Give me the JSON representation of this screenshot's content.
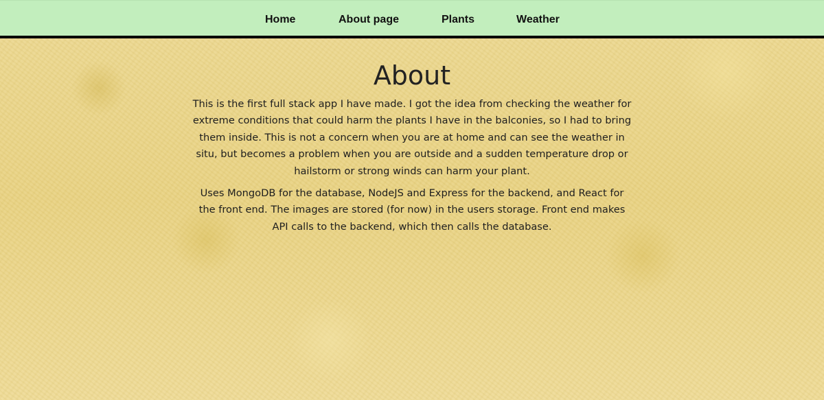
{
  "nav": {
    "items": [
      {
        "label": "Home"
      },
      {
        "label": "About page"
      },
      {
        "label": "Plants"
      },
      {
        "label": "Weather"
      }
    ]
  },
  "about": {
    "title": "About",
    "paragraphs": [
      "This is the first full stack app I have made. I got the idea from checking the weather for extreme conditions that could harm the plants I have in the balconies, so I had to bring them inside. This is not a concern when you are at home and can see the weather in situ, but becomes a problem when you are outside and a sudden temperature drop or hailstorm or strong winds can harm your plant.",
      "Uses MongoDB for the database, NodeJS and Express for the backend, and React for the front end. The images are stored (for now) in the users storage. Front end makes API calls to the backend, which then calls the database."
    ]
  },
  "colors": {
    "navbar_bg": "#c2eebd",
    "navbar_border": "#000000",
    "page_bg": "#e9d48a"
  }
}
